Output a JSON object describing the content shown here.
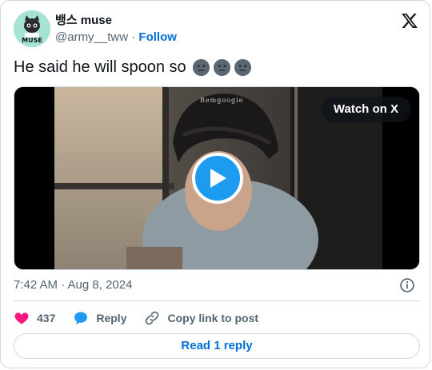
{
  "author": {
    "display_name": "뱅스 muse",
    "handle": "@army__tww",
    "separator": " · ",
    "follow_label": "Follow",
    "avatar_text": "MUSE"
  },
  "tweet": {
    "text": "He said he will spoon so",
    "emoji_count": 3,
    "emoji_icon": "neutral-face-emoji"
  },
  "media": {
    "watch_label": "Watch on X",
    "watermark": "Bemgoogie"
  },
  "meta": {
    "timestamp": "7:42 AM · Aug 8, 2024"
  },
  "actions": {
    "like_count": "437",
    "reply_label": "Reply",
    "copy_label": "Copy link to post"
  },
  "read_reply_label": "Read 1 reply",
  "colors": {
    "link_blue": "#006fd6",
    "play_blue": "#1d9bf0",
    "heart_red": "#f91880",
    "muted": "#536471"
  }
}
